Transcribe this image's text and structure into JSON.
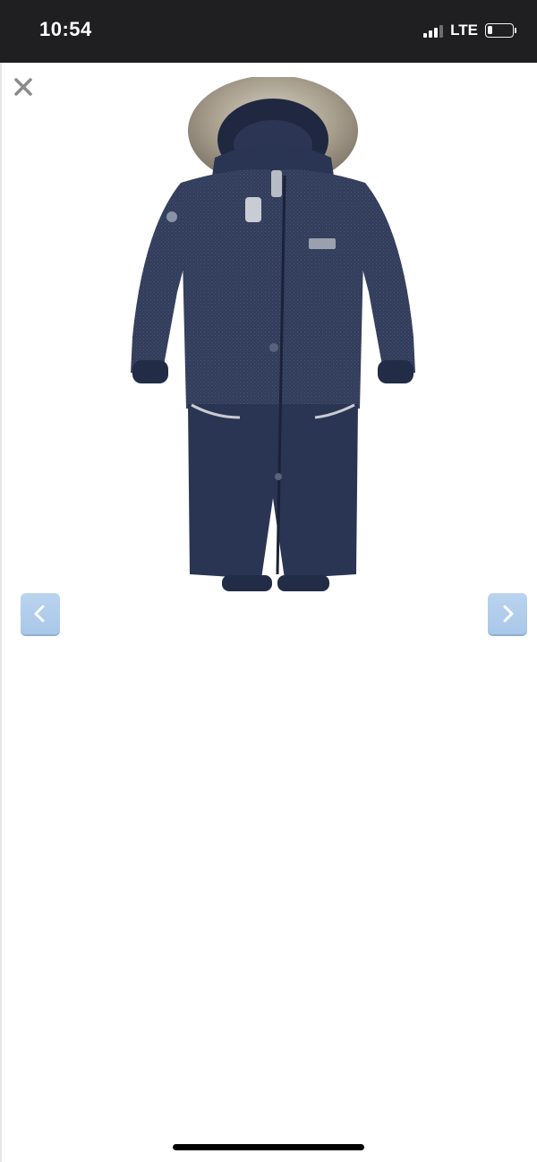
{
  "status_bar": {
    "time": "10:54",
    "network": "LTE",
    "signal_bars_active": 3,
    "battery_level": 0.2
  },
  "viewer": {
    "close_icon": "close-icon",
    "product_image": "navy-winter-snowsuit-with-fur-hood",
    "prev_icon": "chevron-left-icon",
    "next_icon": "chevron-right-icon"
  },
  "colors": {
    "status_bar_bg": "#1f1f21",
    "nav_button_bg": "#b9d4ef",
    "suit_navy": "#2a3553"
  }
}
